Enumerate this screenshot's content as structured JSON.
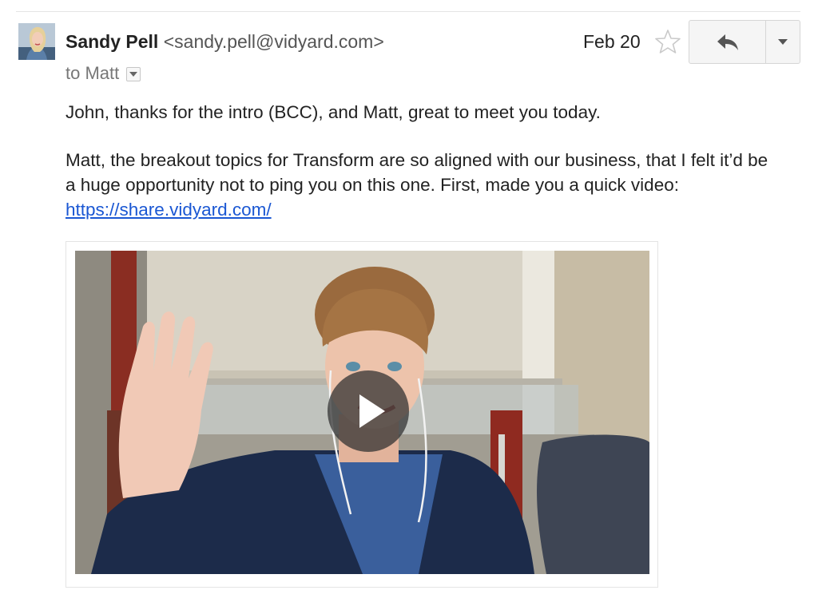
{
  "message": {
    "sender_name": "Sandy Pell",
    "sender_email": "<sandy.pell@vidyard.com>",
    "recipient_line": "to Matt",
    "date": "Feb 20"
  },
  "body": {
    "paragraph1": "John, thanks for the intro (BCC), and Matt, great to meet you today.",
    "paragraph2": "Matt, the breakout topics for Transform are so aligned with our business, that I felt it’d be a huge opportunity not to ping you on this one. First, made you a quick video: ",
    "video_link": "https://share.vidyard.com/"
  },
  "icons": {
    "avatar": "avatar",
    "recipient_dropdown": "chevron-down-icon",
    "star": "star-icon",
    "reply": "reply-icon",
    "more": "caret-down-icon",
    "play": "play-icon"
  },
  "colors": {
    "link": "#1a57d3",
    "play_overlay": "#333333"
  }
}
